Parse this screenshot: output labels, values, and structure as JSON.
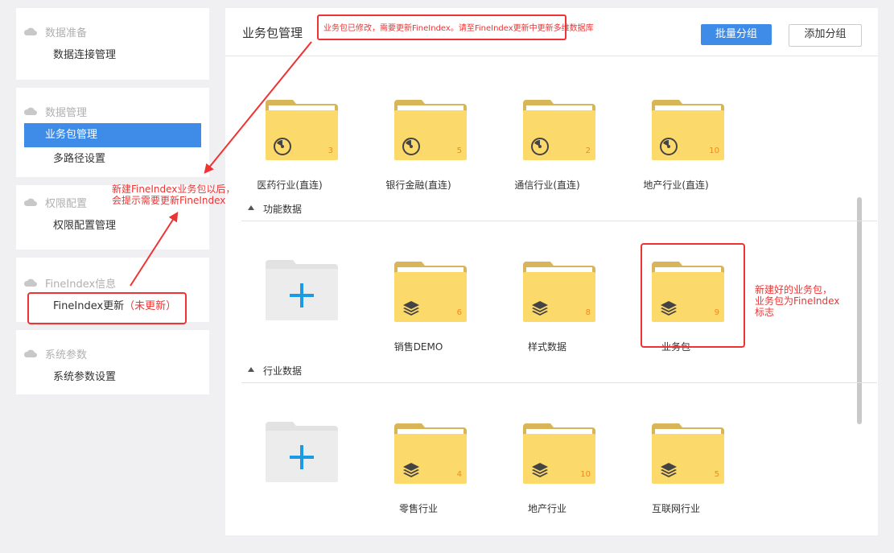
{
  "sidebar": {
    "groups": [
      {
        "heading": "数据准备",
        "items": [
          {
            "label": "数据连接管理"
          }
        ]
      },
      {
        "heading": "数据管理",
        "items": [
          {
            "label": "业务包管理"
          },
          {
            "label": "多路径设置"
          }
        ]
      },
      {
        "heading": "权限配置",
        "items": [
          {
            "label": "权限配置管理"
          }
        ]
      },
      {
        "heading": "FineIndex信息",
        "items": [
          {
            "label": "FineIndex更新",
            "badge": "（未更新）"
          }
        ]
      },
      {
        "heading": "系统参数",
        "items": [
          {
            "label": "系统参数设置"
          }
        ]
      }
    ]
  },
  "header": {
    "title": "业务包管理",
    "notice": "业务包已修改，需要更新FineIndex。请至FineIndex更新中更新多维数据库",
    "batch_group_label": "批量分组",
    "add_group_label": "添加分组"
  },
  "groups": [
    {
      "name": "",
      "packages": [
        {
          "label": "医药行业(直连)",
          "count": "3",
          "type": "direct"
        },
        {
          "label": "银行金融(直连)",
          "count": "5",
          "type": "direct"
        },
        {
          "label": "通信行业(直连)",
          "count": "2",
          "type": "direct"
        },
        {
          "label": "地产行业(直连)",
          "count": "10",
          "type": "direct"
        }
      ]
    },
    {
      "name": "功能数据",
      "packages": [
        {
          "label": "销售DEMO",
          "count": "6",
          "type": "cube"
        },
        {
          "label": "样式数据",
          "count": "8",
          "type": "cube"
        },
        {
          "label": "业务包",
          "count": "9",
          "type": "cube"
        }
      ]
    },
    {
      "name": "行业数据",
      "packages": [
        {
          "label": "零售行业",
          "count": "4",
          "type": "cube"
        },
        {
          "label": "地产行业",
          "count": "10",
          "type": "cube"
        },
        {
          "label": "互联网行业",
          "count": "5",
          "type": "cube"
        }
      ]
    }
  ],
  "annotations": {
    "left_note_line1": "新建FineIndex业务包以后，",
    "left_note_line2": "会提示需要更新FineIndex",
    "right_note_line1": "新建好的业务包，",
    "right_note_line2": "业务包为FineIndex",
    "right_note_line3": "标志"
  },
  "colors": {
    "accent": "#3f8ce8",
    "folder": "#fcd96b",
    "folder_tab": "#d9b55a",
    "annotation": "#e33333",
    "count": "#f08a1a"
  }
}
